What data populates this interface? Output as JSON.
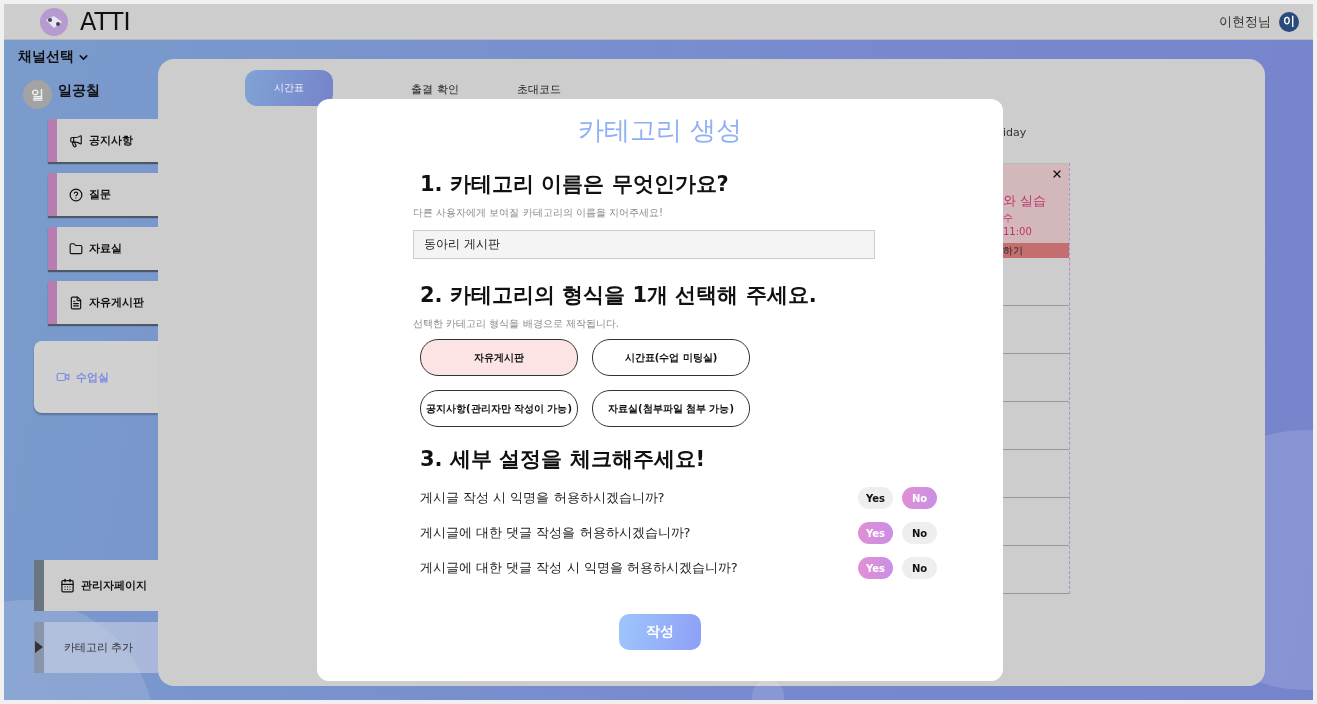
{
  "header": {
    "logo": "ATTI",
    "user_name": "이현정님",
    "user_avatar": "이"
  },
  "sidebar": {
    "channel_select": "채널선택",
    "channel": {
      "avatar": "일",
      "name": "일공칠"
    },
    "items": [
      {
        "label": "공지사항",
        "kind": "notice",
        "selected": false
      },
      {
        "label": "질문",
        "kind": "question",
        "selected": false
      },
      {
        "label": "자료실",
        "kind": "folder",
        "selected": false
      },
      {
        "label": "자유게시판",
        "kind": "board",
        "selected": false
      },
      {
        "label": "수업실",
        "kind": "video",
        "selected": true
      }
    ],
    "admin_items": [
      {
        "label": "관리자페이지",
        "kind": "admin"
      },
      {
        "label": "카테고리 추가",
        "kind": "add"
      }
    ]
  },
  "tabs": [
    {
      "label": "시간표",
      "selected": true
    },
    {
      "label": "출결 확인",
      "selected": false
    },
    {
      "label": "초대코드",
      "selected": false
    }
  ],
  "timetable": {
    "day": "iday",
    "event": {
      "title": "와 실습",
      "subtitle": "수",
      "time": "11:00",
      "action": "하기"
    }
  },
  "modal": {
    "title": "카테고리 생성",
    "name_section": {
      "heading": "1. 카테고리 이름은 무엇인가요?",
      "hint": "다른 사용자에게 보여질 카테고리의 이름을 지어주세요!",
      "value": "동아리 게시판"
    },
    "type_section": {
      "heading": "2. 카테고리의 형식을 1개 선택해 주세요.",
      "hint": "선택한 카테고리 형식을 배경으로 제작됩니다.",
      "options": [
        {
          "label": "자유게시판",
          "selected": true
        },
        {
          "label": "시간표(수업 미팅실)",
          "selected": false
        },
        {
          "label": "공지사항(관리자만 작성이 가능)",
          "selected": false
        },
        {
          "label": "자료실(첨부파일 첨부 가능)",
          "selected": false
        }
      ]
    },
    "settings_section": {
      "heading": "3. 세부 설정을 체크해주세요!",
      "settings": [
        {
          "question": "게시글 작성 시 익명을 허용하시겠습니까?",
          "yes_label": "Yes",
          "no_label": "No",
          "allowed": false
        },
        {
          "question": "게시글에 대한 댓글 작성을 허용하시겠습니까?",
          "yes_label": "Yes",
          "no_label": "No",
          "allowed": true
        },
        {
          "question": "게시글에 대한 댓글 작성 시 익명을 허용하시겠습니까?",
          "yes_label": "Yes",
          "no_label": "No",
          "allowed": true
        }
      ]
    },
    "submit": "작성"
  }
}
